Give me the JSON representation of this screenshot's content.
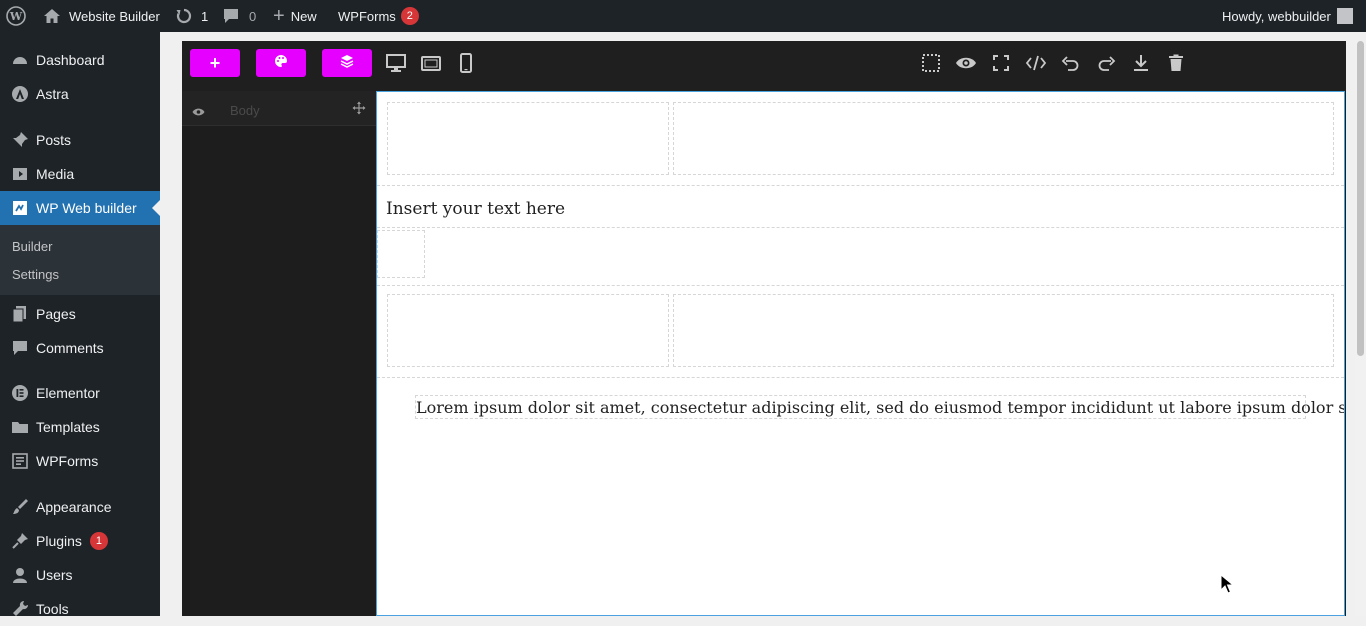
{
  "adminbar": {
    "site_name": "Website Builder",
    "updates_count": "1",
    "comments_count": "0",
    "new_label": "New",
    "wpforms_label": "WPForms",
    "wpforms_badge": "2",
    "howdy": "Howdy, webbuilder"
  },
  "sidebar": {
    "items": [
      {
        "label": "Dashboard",
        "icon": "dashboard-icon"
      },
      {
        "label": "Astra",
        "icon": "astra-icon"
      },
      {
        "label": "Posts",
        "icon": "pin-icon"
      },
      {
        "label": "Media",
        "icon": "media-icon"
      },
      {
        "label": "WP Web builder",
        "icon": "builder-icon"
      },
      {
        "label": "Pages",
        "icon": "pages-icon"
      },
      {
        "label": "Comments",
        "icon": "comments-icon"
      },
      {
        "label": "Elementor",
        "icon": "elementor-icon"
      },
      {
        "label": "Templates",
        "icon": "folder-icon"
      },
      {
        "label": "WPForms",
        "icon": "forms-icon"
      },
      {
        "label": "Appearance",
        "icon": "brush-icon"
      },
      {
        "label": "Plugins",
        "icon": "plugin-icon",
        "badge": "1"
      },
      {
        "label": "Users",
        "icon": "users-icon"
      },
      {
        "label": "Tools",
        "icon": "wrench-icon"
      }
    ],
    "submenu": [
      "Builder",
      "Settings"
    ]
  },
  "builder": {
    "layer_label": "Body",
    "text_block": "Insert your text here",
    "lorem": "Lorem ipsum dolor sit amet, consectetur adipiscing elit, sed do eiusmod tempor incididunt ut labore ipsum dolor sit"
  },
  "colors": {
    "accent": "#e600ff",
    "wp_blue": "#2271b1",
    "admin_dark": "#1d2327"
  }
}
